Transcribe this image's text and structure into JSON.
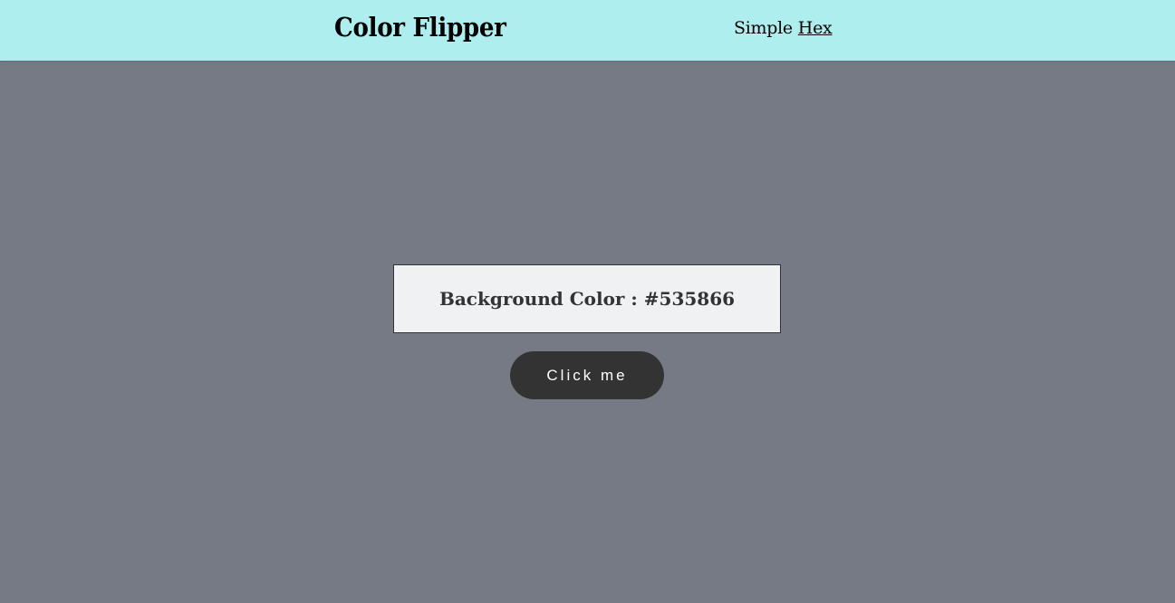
{
  "nav": {
    "title": "Color Flipper",
    "links": [
      "Simple",
      "Hex"
    ]
  },
  "main": {
    "label": "Background Color : ",
    "color_value": "#535866",
    "button_label": "Click me"
  },
  "colors": {
    "nav_bg": "#afeeee",
    "button_bg": "#333333"
  }
}
